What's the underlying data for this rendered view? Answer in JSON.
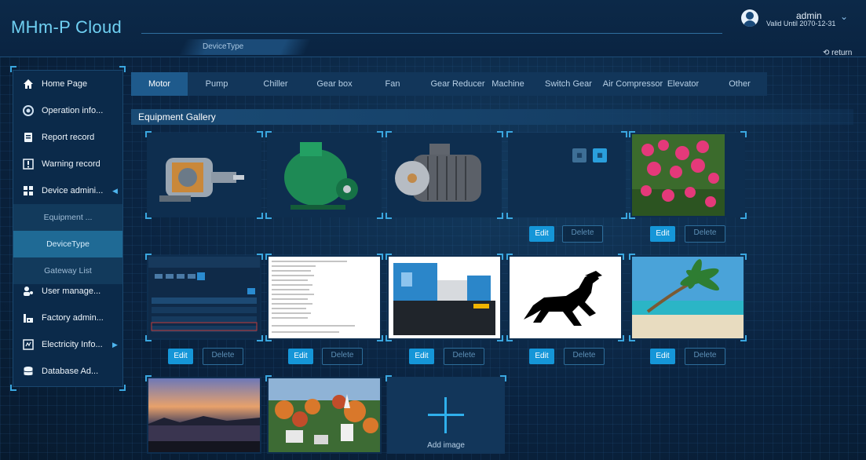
{
  "app": {
    "title": "MHm-P Cloud",
    "section_tab": "DeviceType"
  },
  "user": {
    "name": "admin",
    "valid_until": "Valid Until 2070-12-31"
  },
  "header": {
    "return_label": "return"
  },
  "sidebar": {
    "items": [
      {
        "label": "Home Page",
        "icon": "home-icon"
      },
      {
        "label": "Operation info...",
        "icon": "operation-icon"
      },
      {
        "label": "Report record",
        "icon": "report-icon"
      },
      {
        "label": "Warning record",
        "icon": "warning-icon"
      },
      {
        "label": "Device admini...",
        "icon": "device-icon"
      },
      {
        "label": "Equipment ...",
        "icon": ""
      },
      {
        "label": "DeviceType",
        "icon": ""
      },
      {
        "label": "Gateway List",
        "icon": ""
      },
      {
        "label": "User manage...",
        "icon": "user-icon"
      },
      {
        "label": "Factory admin...",
        "icon": "factory-icon"
      },
      {
        "label": "Electricity Info...",
        "icon": "electricity-icon"
      },
      {
        "label": "Database Ad...",
        "icon": "database-icon"
      }
    ]
  },
  "tabs": [
    {
      "label": "Motor"
    },
    {
      "label": "Pump"
    },
    {
      "label": "Chiller"
    },
    {
      "label": "Gear box"
    },
    {
      "label": "Fan"
    },
    {
      "label": "Gear Reducer"
    },
    {
      "label": "Machine"
    },
    {
      "label": "Switch Gear"
    },
    {
      "label": "Air Compressor"
    },
    {
      "label": "Elevator"
    },
    {
      "label": "Other"
    }
  ],
  "gallery": {
    "title": "Equipment Gallery",
    "edit_label": "Edit",
    "delete_label": "Delete",
    "add_label": "Add image"
  },
  "colors": {
    "accent": "#1596d8",
    "logo": "#6fd0f2",
    "active_tab": "#1e5a8c"
  }
}
